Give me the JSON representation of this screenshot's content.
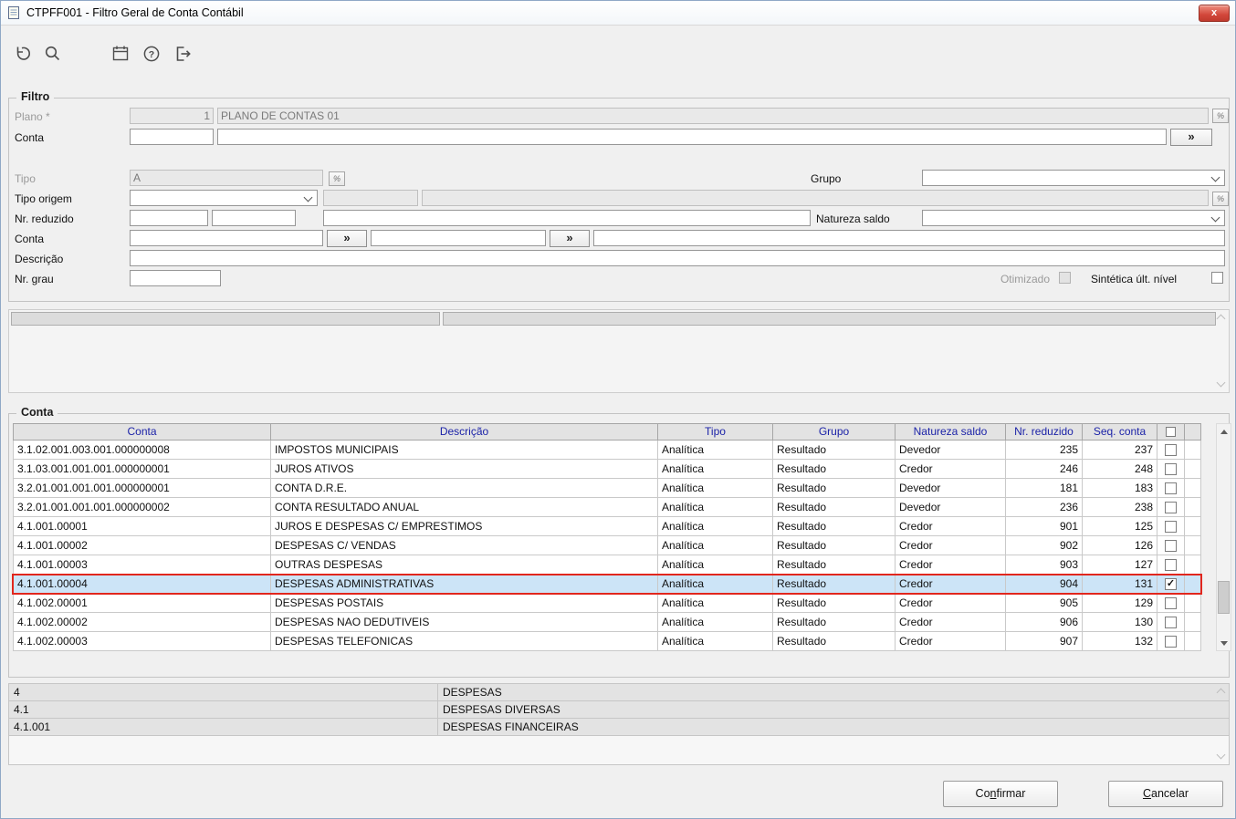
{
  "window": {
    "title": "CTPFF001 - Filtro Geral de Conta Contábil",
    "close_glyph": "x"
  },
  "toolbar": {
    "icons": [
      "undo-icon",
      "search-icon",
      "calendar-icon",
      "help-icon",
      "exit-icon"
    ]
  },
  "filtro": {
    "legend": "Filtro",
    "lookup_glyph": "%",
    "more_glyph": "»",
    "plano": {
      "label": "Plano *",
      "value": "1",
      "description": "PLANO DE CONTAS 01"
    },
    "conta_top": {
      "label": "Conta",
      "value": "",
      "wide_value": ""
    },
    "tipo": {
      "label": "Tipo",
      "value": "A"
    },
    "grupo": {
      "label": "Grupo",
      "value": ""
    },
    "tipo_origem": {
      "label": "Tipo origem",
      "value": ""
    },
    "nr_reduzido": {
      "label": "Nr. reduzido",
      "value1": "",
      "value2": "",
      "extra": ""
    },
    "natureza_saldo": {
      "label": "Natureza saldo",
      "value": ""
    },
    "conta_range": {
      "label": "Conta",
      "from": "",
      "to": "",
      "extra": ""
    },
    "descricao": {
      "label": "Descrição",
      "value": ""
    },
    "nr_grau": {
      "label": "Nr. grau",
      "value": ""
    },
    "otimizado": {
      "label": "Otimizado",
      "checked": false
    },
    "sintetica": {
      "label": "Sintética últ. nível",
      "checked": false
    }
  },
  "conta": {
    "legend": "Conta",
    "table": {
      "headers": [
        "Conta",
        "Descrição",
        "Tipo",
        "Grupo",
        "Natureza saldo",
        "Nr. reduzido",
        "Seq. conta"
      ],
      "rows": [
        {
          "conta": "3.1.02.001.003.001.000000008",
          "descricao": "IMPOSTOS MUNICIPAIS",
          "tipo": "Analítica",
          "grupo": "Resultado",
          "natureza": "Devedor",
          "nr_reduzido": "235",
          "seq": "237",
          "checked": false,
          "selected": false
        },
        {
          "conta": "3.1.03.001.001.001.000000001",
          "descricao": "JUROS ATIVOS",
          "tipo": "Analítica",
          "grupo": "Resultado",
          "natureza": "Credor",
          "nr_reduzido": "246",
          "seq": "248",
          "checked": false,
          "selected": false
        },
        {
          "conta": "3.2.01.001.001.001.000000001",
          "descricao": "CONTA D.R.E.",
          "tipo": "Analítica",
          "grupo": "Resultado",
          "natureza": "Devedor",
          "nr_reduzido": "181",
          "seq": "183",
          "checked": false,
          "selected": false
        },
        {
          "conta": "3.2.01.001.001.001.000000002",
          "descricao": "CONTA RESULTADO ANUAL",
          "tipo": "Analítica",
          "grupo": "Resultado",
          "natureza": "Devedor",
          "nr_reduzido": "236",
          "seq": "238",
          "checked": false,
          "selected": false
        },
        {
          "conta": "4.1.001.00001",
          "descricao": "JUROS E DESPESAS C/ EMPRESTIMOS",
          "tipo": "Analítica",
          "grupo": "Resultado",
          "natureza": "Credor",
          "nr_reduzido": "901",
          "seq": "125",
          "checked": false,
          "selected": false
        },
        {
          "conta": "4.1.001.00002",
          "descricao": "DESPESAS C/ VENDAS",
          "tipo": "Analítica",
          "grupo": "Resultado",
          "natureza": "Credor",
          "nr_reduzido": "902",
          "seq": "126",
          "checked": false,
          "selected": false
        },
        {
          "conta": "4.1.001.00003",
          "descricao": "OUTRAS DESPESAS",
          "tipo": "Analítica",
          "grupo": "Resultado",
          "natureza": "Credor",
          "nr_reduzido": "903",
          "seq": "127",
          "checked": false,
          "selected": false
        },
        {
          "conta": "4.1.001.00004",
          "descricao": "DESPESAS ADMINISTRATIVAS",
          "tipo": "Analítica",
          "grupo": "Resultado",
          "natureza": "Credor",
          "nr_reduzido": "904",
          "seq": "131",
          "checked": true,
          "selected": true
        },
        {
          "conta": "4.1.002.00001",
          "descricao": "DESPESAS POSTAIS",
          "tipo": "Analítica",
          "grupo": "Resultado",
          "natureza": "Credor",
          "nr_reduzido": "905",
          "seq": "129",
          "checked": false,
          "selected": false
        },
        {
          "conta": "4.1.002.00002",
          "descricao": "DESPESAS NAO DEDUTIVEIS",
          "tipo": "Analítica",
          "grupo": "Resultado",
          "natureza": "Credor",
          "nr_reduzido": "906",
          "seq": "130",
          "checked": false,
          "selected": false
        },
        {
          "conta": "4.1.002.00003",
          "descricao": "DESPESAS TELEFONICAS",
          "tipo": "Analítica",
          "grupo": "Resultado",
          "natureza": "Credor",
          "nr_reduzido": "907",
          "seq": "132",
          "checked": false,
          "selected": false
        }
      ]
    }
  },
  "hierarchy": {
    "rows": [
      {
        "code": "4",
        "descricao": "DESPESAS"
      },
      {
        "code": "4.1",
        "descricao": "DESPESAS DIVERSAS"
      },
      {
        "code": "4.1.001",
        "descricao": "DESPESAS FINANCEIRAS"
      }
    ]
  },
  "footer": {
    "confirm": {
      "pre": "Co",
      "key": "n",
      "post": "firmar"
    },
    "cancel": {
      "pre": "",
      "key": "C",
      "post": "ancelar"
    }
  },
  "colors": {
    "selection_border": "#e1261d",
    "selection_bg": "#cce4f7",
    "grid_header_text": "#1c23a8",
    "close_button": "#d2473a"
  }
}
